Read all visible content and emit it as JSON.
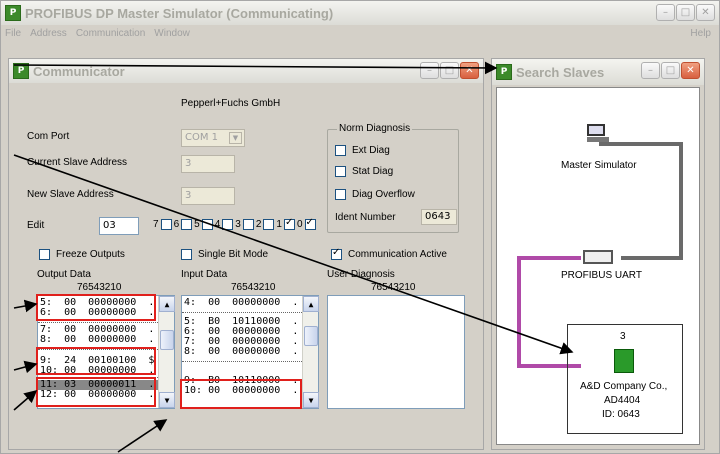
{
  "app": {
    "title": "PROFIBUS DP Master Simulator (Communicating)",
    "menu": [
      "File",
      "Address",
      "Communication",
      "Window"
    ],
    "help": "Help"
  },
  "communicator": {
    "title": "Communicator",
    "company": "Pepperl+Fuchs GmbH",
    "com_port_label": "Com Port",
    "com_port_value": "COM 1",
    "current_slave_label": "Current Slave Address",
    "current_slave_value": "3",
    "new_slave_label": "New Slave Address",
    "new_slave_value": "3",
    "edit_label": "Edit",
    "edit_value": "03",
    "bits": [
      {
        "n": "7",
        "c": false
      },
      {
        "n": "6",
        "c": false
      },
      {
        "n": "5",
        "c": false
      },
      {
        "n": "4",
        "c": false
      },
      {
        "n": "3",
        "c": false
      },
      {
        "n": "2",
        "c": false
      },
      {
        "n": "1",
        "c": true
      },
      {
        "n": "0",
        "c": true
      }
    ],
    "norm_diag": {
      "title": "Norm Diagnosis",
      "ext_diag": "Ext Diag",
      "stat_diag": "Stat Diag",
      "diag_overflow": "Diag Overflow",
      "ident_label": "Ident Number",
      "ident_value": "0643"
    },
    "freeze_outputs": "Freeze Outputs",
    "single_bit_mode": "Single Bit Mode",
    "communication_active": "Communication Active",
    "output_data_label": "Output Data",
    "input_data_label": "Input Data",
    "user_diag_label": "User Diagnosis",
    "bit_header": "76543210",
    "output_rows": [
      "5:  00  00000000  .",
      "6:  00  00000000  .",
      "7:  00  00000000  .",
      "8:  00  00000000  .",
      "9:  24  00100100  $",
      "10: 00  00000000  .",
      "11: 03  00000011  .",
      "12: 00  00000000  ."
    ],
    "input_rows": [
      "4:  00  00000000  .",
      "5:  B0  10110000  .",
      "6:  00  00000000  .",
      "7:  00  00000000  .",
      "8:  00  00000000  .",
      "9:  B0  10110000  .",
      "10: 00  00000000  ."
    ]
  },
  "search_slaves": {
    "title": "Search Slaves",
    "master_label": "Master Simulator",
    "uart_label": "PROFIBUS UART",
    "slave_address": "3",
    "slave_company": "A&D Company Co.,",
    "slave_model": "AD4404",
    "slave_id": "ID: 0643"
  },
  "colors": {
    "red_box": "#e0201c",
    "bus_purple": "#b04aa8",
    "bus_gray": "#6a6a6a",
    "arrow": "#000000"
  }
}
